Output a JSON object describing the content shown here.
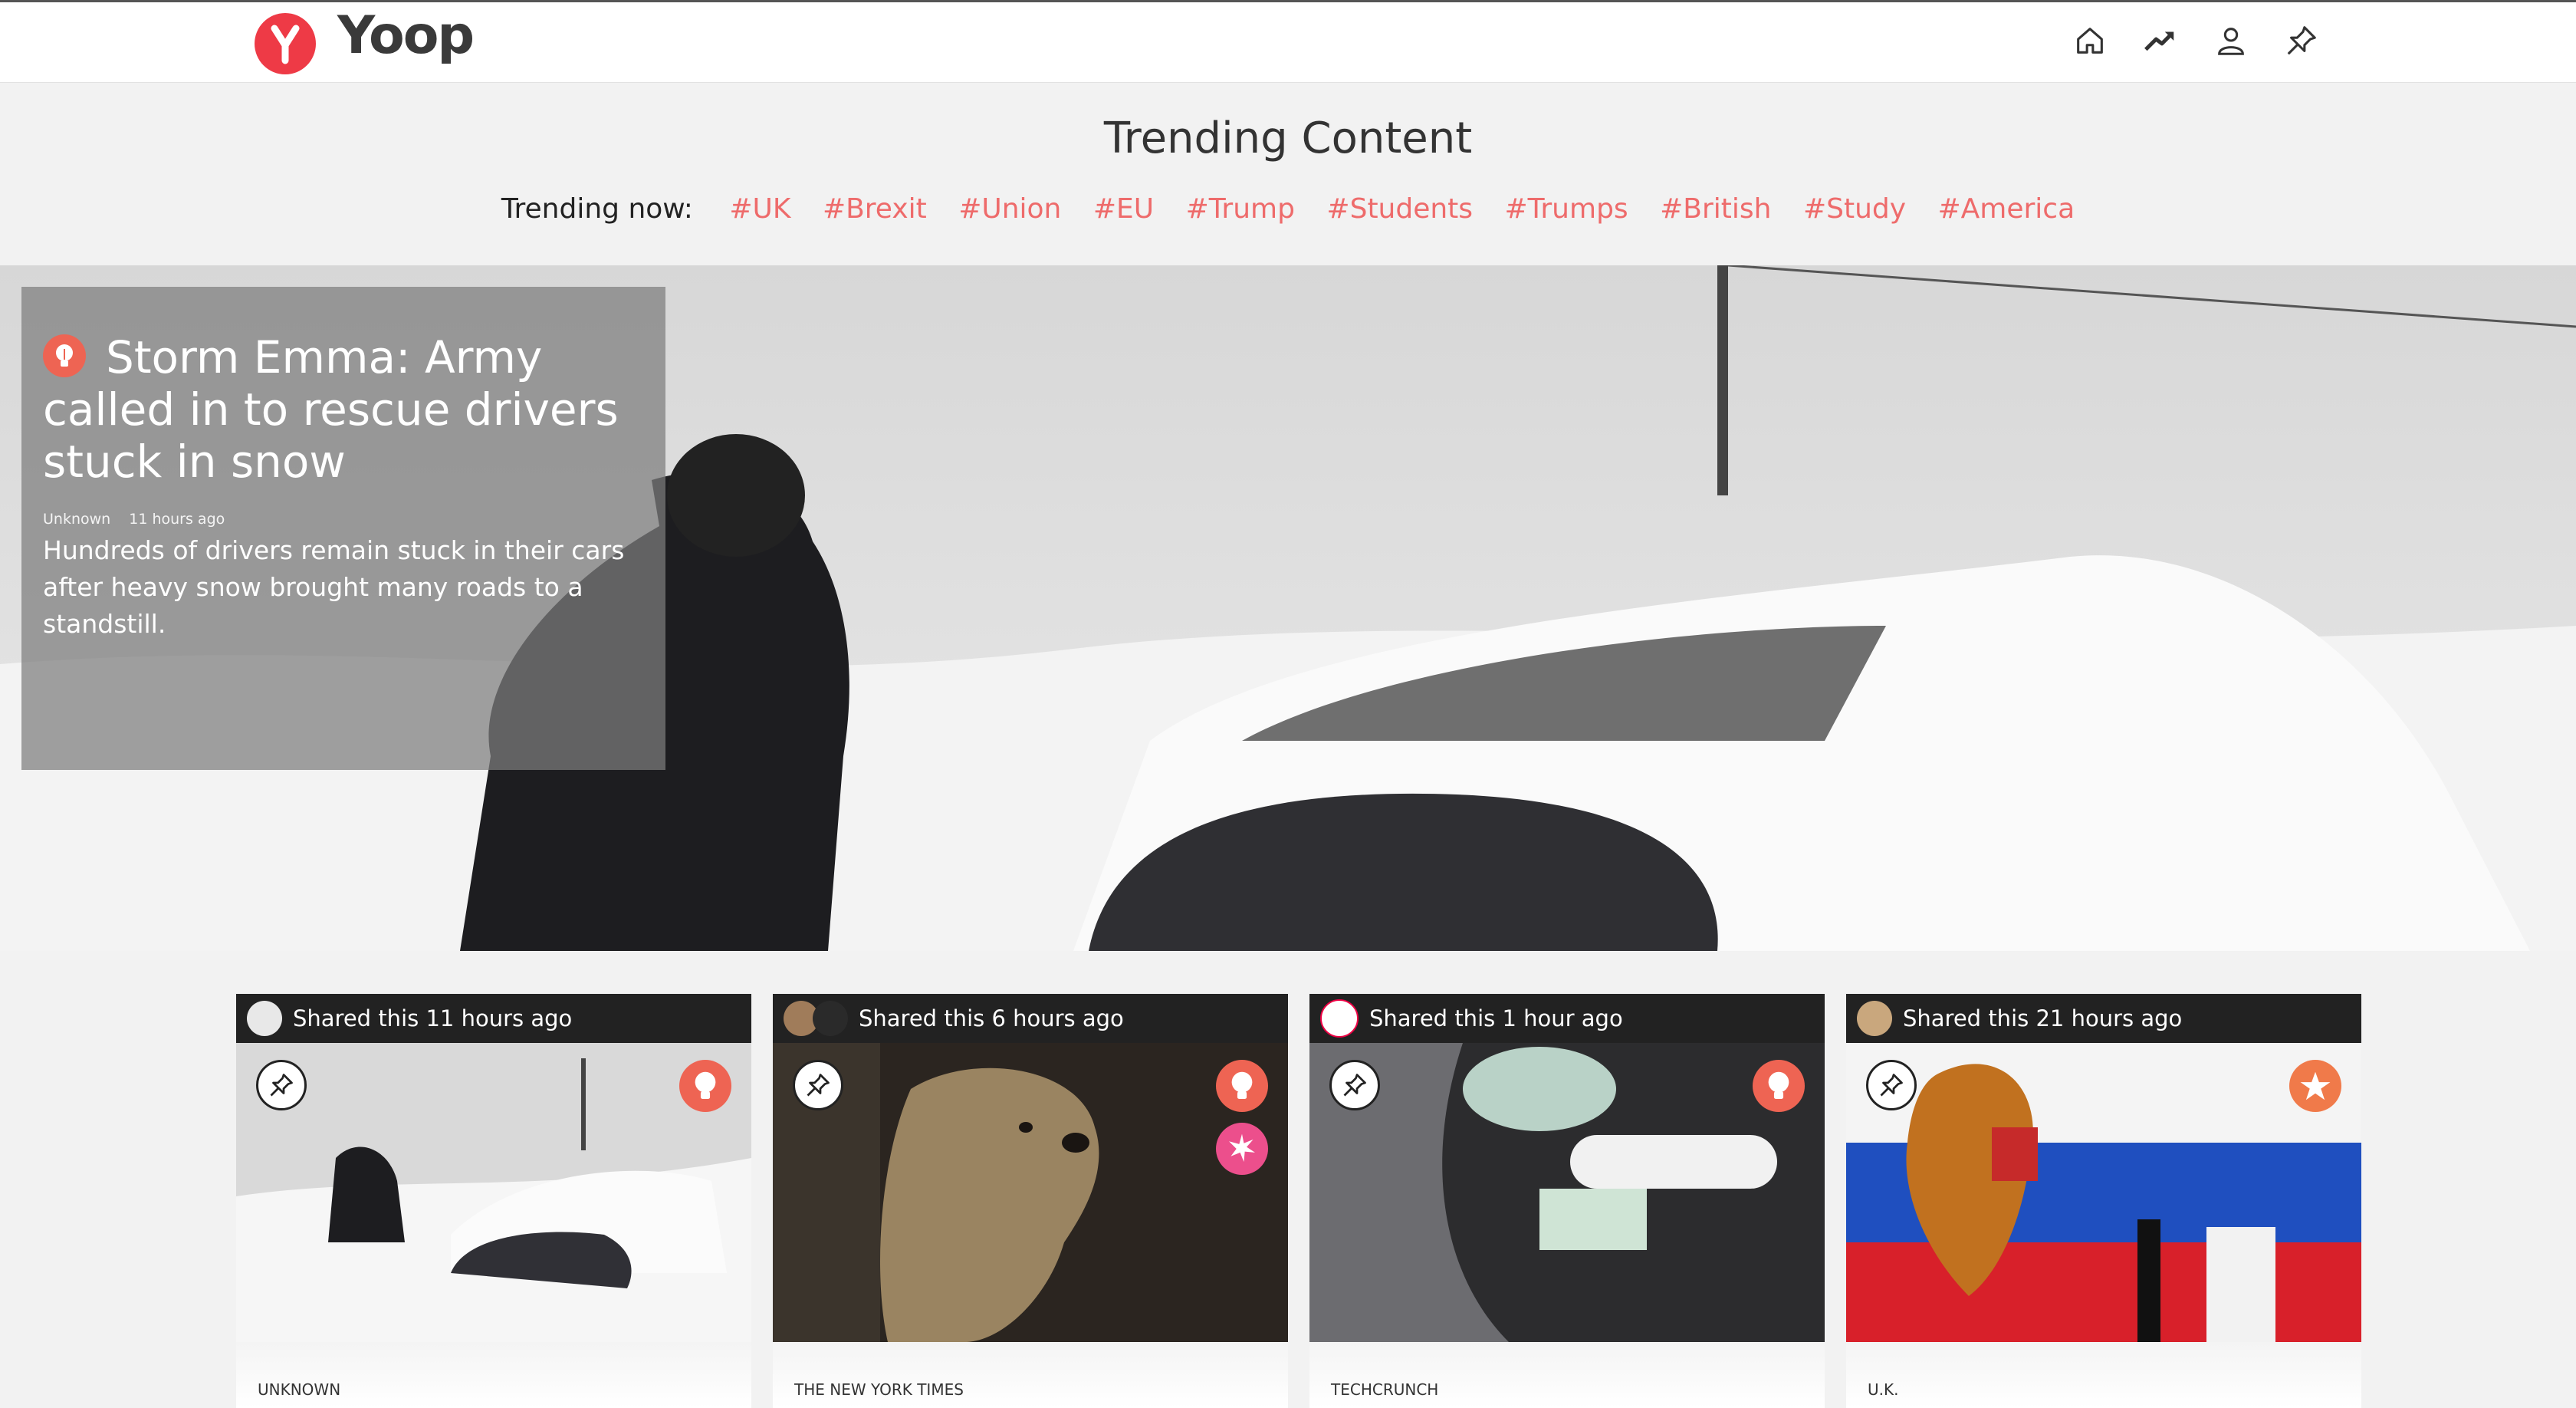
{
  "app": {
    "brand": "Yoop",
    "accent": "#ee3a46",
    "tag_color": "#ee6b6b"
  },
  "nav": {
    "icons": [
      "home-icon",
      "trending-icon",
      "profile-icon",
      "pin-icon"
    ]
  },
  "page": {
    "title": "Trending Content"
  },
  "trending": {
    "label": "Trending now:",
    "tags": [
      "#UK",
      "#Brexit",
      "#Union",
      "#EU",
      "#Trump",
      "#Students",
      "#Trumps",
      "#British",
      "#Study",
      "#America"
    ]
  },
  "hero": {
    "title": "Storm Emma: Army called in to rescue drivers stuck in snow",
    "source": "Unknown",
    "time": "11 hours ago",
    "description": "Hundreds of drivers remain stuck in their cars after heavy snow brought many roads to a standstill.",
    "badge_icon": "lightbulb-icon"
  },
  "cards": [
    {
      "shared": "Shared this 11 hours ago",
      "source": "UNKNOWN",
      "badges": [
        "lightbulb-icon"
      ]
    },
    {
      "shared": "Shared this 6 hours ago",
      "source": "THE NEW YORK TIMES",
      "badges": [
        "lightbulb-icon",
        "fireworks-icon"
      ]
    },
    {
      "shared": "Shared this 1 hour ago",
      "source": "TECHCRUNCH",
      "badges": [
        "lightbulb-icon"
      ]
    },
    {
      "shared": "Shared this 21 hours ago",
      "source": "U.K.",
      "badges": [
        "star-icon"
      ]
    }
  ]
}
